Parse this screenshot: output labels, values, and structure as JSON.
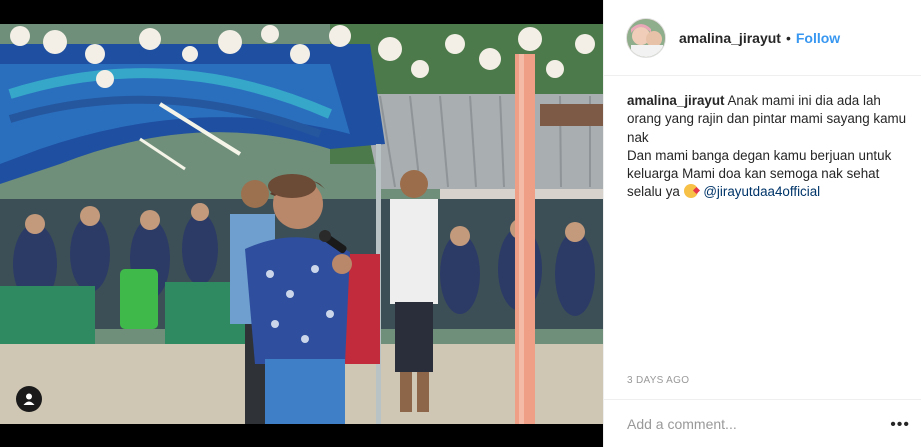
{
  "post": {
    "username": "amalina_jirayut",
    "separator": "•",
    "follow_label": "Follow",
    "caption_user": "amalina_jirayut",
    "caption_lines": [
      "Anak mami ini dia ada lah orang yang rajin dan pintar mami sayang kamu nak",
      "Dan mami banga degan kamu berjuan untuk keluarga Mami doa kan semoga nak sehat selalu ya"
    ],
    "mention": "@jirayutdaa4official",
    "time": "3 DAYS AGO",
    "comment_placeholder": "Add a comment...",
    "more_label": "•••"
  },
  "icons": {
    "user_tag": "person-icon",
    "emoji": "face-blowing-kiss-icon"
  },
  "colors": {
    "follow": "#3897f0",
    "mention": "#003569",
    "muted": "#999999"
  }
}
